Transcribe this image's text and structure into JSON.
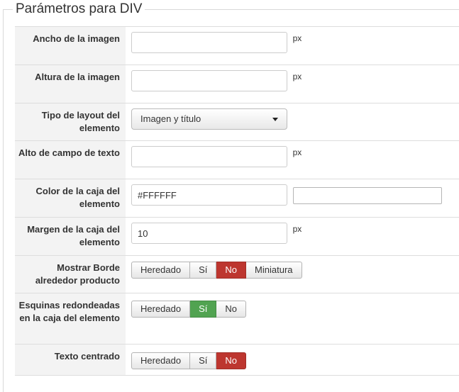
{
  "fieldset": {
    "legend": "Parámetros para DIV"
  },
  "rows": {
    "ancho": {
      "label": "Ancho de la imagen",
      "value": "",
      "unit": "px"
    },
    "altura": {
      "label": "Altura de la imagen",
      "value": "",
      "unit": "px"
    },
    "layout": {
      "label": "Tipo de layout del elemento",
      "selected": "Imagen y título"
    },
    "alto_campo": {
      "label": "Alto de campo de texto",
      "value": "",
      "unit": "px"
    },
    "color_caja": {
      "label": "Color de la caja del elemento",
      "value": "#FFFFFF",
      "swatch_color": "#FFFFFF"
    },
    "margen": {
      "label": "Margen de la caja del elemento",
      "value": "10",
      "unit": "px"
    },
    "mostrar_borde": {
      "label": "Mostrar Borde alrededor producto",
      "options": [
        "Heredado",
        "Sí",
        "No",
        "Miniatura"
      ],
      "selected": "No"
    },
    "esquinas": {
      "label": "Esquinas redondeadas en la caja del elemento",
      "options": [
        "Heredado",
        "Sí",
        "No"
      ],
      "selected": "Sí"
    },
    "texto_centrado": {
      "label": "Texto centrado",
      "options": [
        "Heredado",
        "Sí",
        "No"
      ],
      "selected": "No"
    }
  },
  "colors": {
    "active_no": "#bd362f",
    "active_si": "#51a351"
  }
}
